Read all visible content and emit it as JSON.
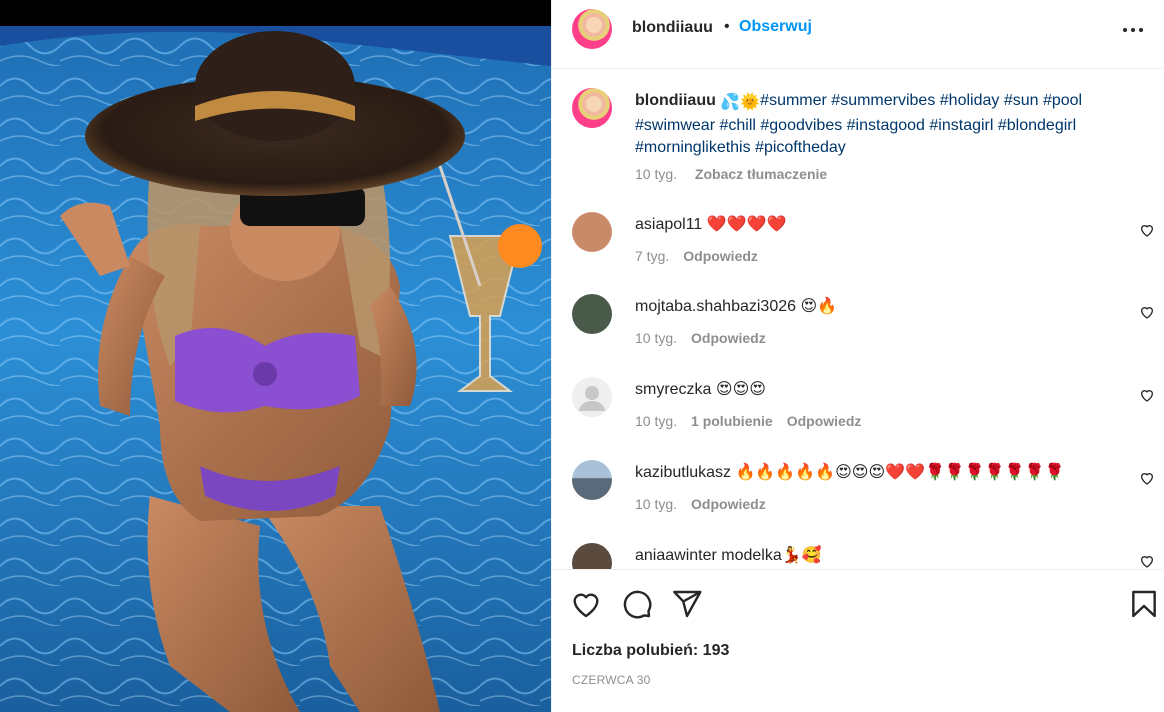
{
  "post": {
    "image_alt": "Woman in a wide-brimmed straw hat and purple bikini sitting in a pool holding a cocktail"
  },
  "header": {
    "username": "blondiiauu",
    "separator": "•",
    "follow_label": "Obserwuj",
    "more_icon": "more-horizontal-icon"
  },
  "caption": {
    "username": "blondiiauu",
    "emoji": [
      "💦",
      "🌞"
    ],
    "hashtags": "#summer #summervibes #holiday #sun #pool #swimwear #chill #goodvibes #instagood #instagirl #blondegirl #morninglikethis #picoftheday",
    "age": "10 tyg.",
    "translate_label": "Zobacz tłumaczenie"
  },
  "comments": [
    {
      "username": "asiapol11",
      "text": "❤️❤️❤️❤️",
      "age": "7 tyg.",
      "likes": "",
      "reply_label": "Odpowiedz",
      "avatar_color": "#c98a6a"
    },
    {
      "username": "mojtaba.shahbazi3026",
      "text": "😍🔥",
      "age": "10 tyg.",
      "likes": "",
      "reply_label": "Odpowiedz",
      "avatar_color": "#4a5a4a"
    },
    {
      "username": "smyreczka",
      "text": "😍😍😍",
      "age": "10 tyg.",
      "likes": "1 polubienie",
      "reply_label": "Odpowiedz",
      "avatar_color": "#dbdbdb"
    },
    {
      "username": "kazibutlukasz",
      "text": "🔥🔥🔥🔥🔥😍😍😍❤️❤️🌹🌹🌹🌹🌹🌹🌹",
      "age": "10 tyg.",
      "likes": "",
      "reply_label": "Odpowiedz",
      "avatar_color": "#8fa9c4"
    },
    {
      "username": "aniaawinter",
      "text": "modelka💃🥰",
      "age": "",
      "likes": "",
      "reply_label": "",
      "avatar_color": "#5b4a3e"
    }
  ],
  "actions": {
    "like_icon": "heart-icon",
    "comment_icon": "comment-icon",
    "share_icon": "share-icon",
    "save_icon": "bookmark-icon"
  },
  "likes_label": "Liczba polubień: 193",
  "date": "CZERWCA 30",
  "colors": {
    "link_blue": "#0095f6",
    "hashtag_blue": "#00376b",
    "muted_gray": "#8e8e8e",
    "heart_red": "#ed4956"
  }
}
